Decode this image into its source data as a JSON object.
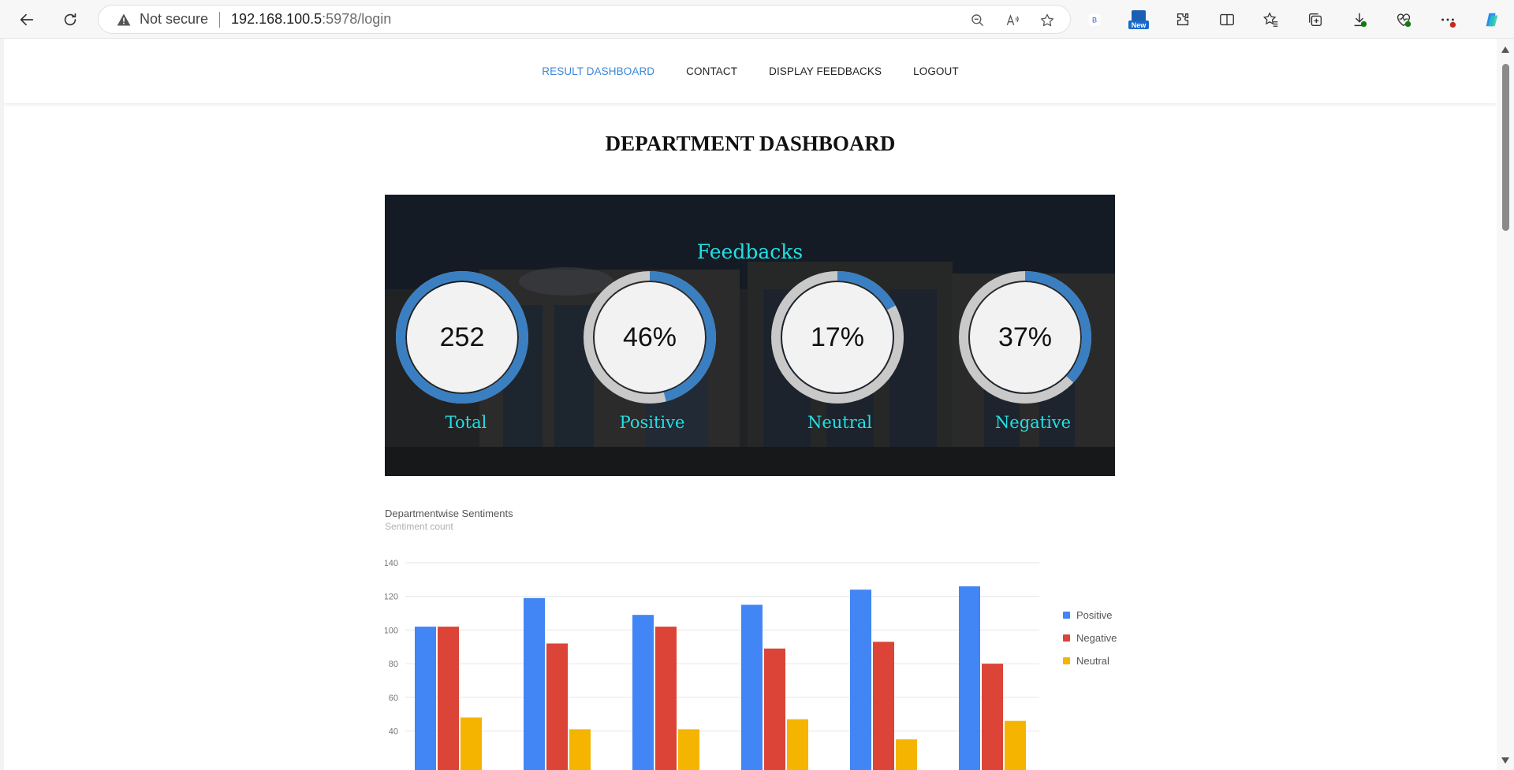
{
  "browser": {
    "not_secure": "Not secure",
    "url_host": "192.168.100.5",
    "url_rest": ":5978/login",
    "ext_new_badge": "New",
    "ext_b_badge": "B"
  },
  "nav": {
    "items": [
      "RESULT DASHBOARD",
      "CONTACT",
      "DISPLAY FEEDBACKS",
      "LOGOUT"
    ],
    "active": 0
  },
  "page": {
    "title": "DEPARTMENT DASHBOARD"
  },
  "feedbacks": {
    "title": "Feedbacks",
    "gauges": [
      {
        "label": "Total",
        "value": "252",
        "fraction": 1.0
      },
      {
        "label": "Positive",
        "value": "46%",
        "fraction": 0.46
      },
      {
        "label": "Neutral",
        "value": "17%",
        "fraction": 0.17
      },
      {
        "label": "Negative",
        "value": "37%",
        "fraction": 0.37
      }
    ],
    "colors": {
      "arc": "#3a7fc1",
      "track": "#c9c9c9",
      "inner": "#f2f2f2",
      "label": "#22e0e6"
    }
  },
  "chart_data": {
    "type": "bar",
    "title": "Departmentwise Sentiments",
    "subtitle": "Sentiment count",
    "ylim": [
      20,
      140
    ],
    "yticks": [
      40,
      60,
      80,
      100,
      120,
      140
    ],
    "categories": [
      "",
      "",
      "",
      "",
      "",
      ""
    ],
    "series": [
      {
        "name": "Positive",
        "color": "#4285f4",
        "values": [
          102,
          119,
          109,
          115,
          124,
          126
        ]
      },
      {
        "name": "Negative",
        "color": "#db4437",
        "values": [
          102,
          92,
          102,
          89,
          93,
          80
        ]
      },
      {
        "name": "Neutral",
        "color": "#f4b400",
        "values": [
          48,
          41,
          41,
          47,
          35,
          46
        ]
      }
    ],
    "legend_position": "right",
    "grid": true
  }
}
